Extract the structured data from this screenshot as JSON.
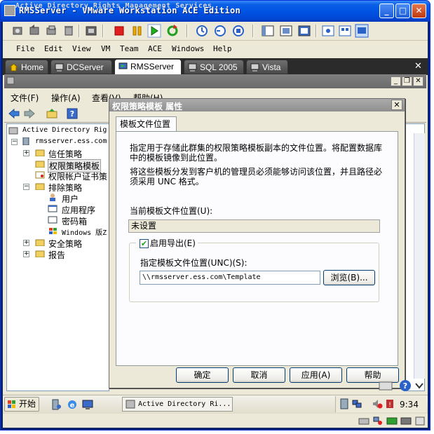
{
  "window": {
    "title": "RMSServer - VMware Workstation ACE Edition",
    "minimize_glyph": "_",
    "maximize_glyph": "□",
    "close_glyph": "✕"
  },
  "vmware_menu": [
    "File",
    "Edit",
    "View",
    "VM",
    "Team",
    "ACE",
    "Windows",
    "Help"
  ],
  "vm_tabs": [
    {
      "label": "Home",
      "icon": "home-icon"
    },
    {
      "label": "DCServer",
      "icon": "vm-icon"
    },
    {
      "label": "RMSServer",
      "icon": "vm-icon",
      "active": true
    },
    {
      "label": "SQL 2005",
      "icon": "vm-icon"
    },
    {
      "label": "Vista",
      "icon": "vm-icon"
    }
  ],
  "tabbar_close": "✕",
  "mmc": {
    "title": "Active Directory Rights Management Services",
    "menu": [
      "文件(F)",
      "操作(A)",
      "查看(V)",
      "帮助(H)"
    ]
  },
  "tree": {
    "root": "Active Directory Rig",
    "server": "rmsserver.ess.com",
    "items": [
      "信任策略",
      "权限策略模板",
      "权限帐户证书策",
      "排除策略",
      "用户",
      "应用程序",
      "密码箱",
      "Windows 版Z",
      "安全策略",
      "报告"
    ]
  },
  "dialog": {
    "title": "权限策略模板 属性",
    "close_glyph": "✕",
    "tab": "模板文件位置",
    "desc1": "指定用于存储此群集的权限策略模板副本的文件位置。将配置数据库中的模板镜像到此位置。",
    "desc2": "将这些模板分发到客户机的管理员必须能够访问该位置，并且路径必须采用 UNC 格式。",
    "current_label": "当前模板文件位置(U):",
    "current_value": "未设置",
    "enable_export": "启用导出(E)",
    "enable_export_checked": true,
    "unc_label": "指定模板文件位置(UNC)(S):",
    "unc_value": "\\\\rmsserver.ess.com\\Template",
    "browse": "浏览(B)...",
    "ok": "确定",
    "cancel": "取消",
    "apply": "应用(A)",
    "help": "帮助"
  },
  "taskbar": {
    "start": "开始",
    "task": "Active Directory Ri...",
    "clock": "9:34"
  },
  "colors": {
    "xp_title": "#0054e3",
    "tab_bar": "#2b2b2b",
    "dialog_bg": "#ece9d8"
  }
}
